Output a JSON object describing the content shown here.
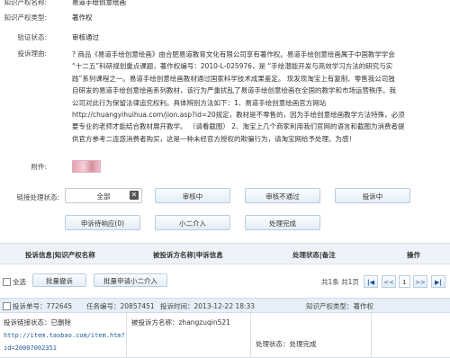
{
  "info": {
    "ip_name_label": "知识产权名称:",
    "ip_name": "易道手绘创意绘画",
    "ip_type_label": "知识产权类型:",
    "ip_type": "著作权",
    "status_label": "验证状态:",
    "status": "审核通过",
    "reason_label": "投诉理由:",
    "reason_lines": [
      "? 商品《易道手绘创意绘画》由合肥易道教育文化有限公司享有著作权。易道手绘创意绘画属于中国教学学会",
      "“十二五”科研规划重点课题，著作权编号：2010-L-025976，是 “手绘潜能开发与高效学习方法的研究与实",
      "践”系列课程之一。易道手绘创意绘画教材通过国家科学技术成果鉴定。 现发现淘宝上有复制、零售我公司独",
      "自研发的易道手绘创意绘画系列教材，该行为严重扰乱了易道手绘创意绘画在全国的教学和市场运营秩序。我",
      "公司对此行为保留法律追究权利。具体辨别方法如下：1、易道手绘创意绘画官方网站",
      "http://chuangyihuihua.com/jion.asp?id=20规定，教材是不零售的，因为手绘创意绘画教学方法特殊，必须",
      "要专业的老师才能结合教材展开教学。 （请看截图） 2、淘宝上几个商家利用我们官网的语言和截图为消费者提",
      "供官方参考二连惑消费者购买，这是一种未经官方授权的欺骗行为，请淘宝网给予处理。为感！"
    ],
    "attachment_label": "附件:"
  },
  "filters": {
    "label": "链接处理状态:",
    "selected": "全部",
    "clear_icon": "close-icon",
    "buttons": [
      "审核中",
      "审核不通过",
      "投诉中",
      "申诉待响应(0)",
      "小二介入",
      "处理完成"
    ]
  },
  "table": {
    "headers": [
      "投诉信息|知识产权名称",
      "被投诉方名称|申诉信息",
      "处理状态|备注",
      "操作"
    ]
  },
  "toolbar": {
    "select_all": "全选",
    "batch_withdraw": "批量撤诉",
    "batch_escalate": "批量申请小二介入",
    "page_info": "共1条 共1页",
    "first": "|◀",
    "prev": "<<",
    "current_page": "1",
    "next": ">>",
    "last": "▶|"
  },
  "record": {
    "complaint_no": "投诉单号：772645",
    "task_no": "任务编号：20857451",
    "complaint_time": "投诉时间：2013-12-22 18:33",
    "ip_type": "知识产权类型：著作权",
    "link_status": "投诉链接状态：已删除",
    "link_url_1": "http://item.taobao.com/item.htm?",
    "link_url_2": "id=20007002351",
    "respondent": "被投诉方名称：zhangzuqin521",
    "process_status": "处理状态：处理完成"
  }
}
